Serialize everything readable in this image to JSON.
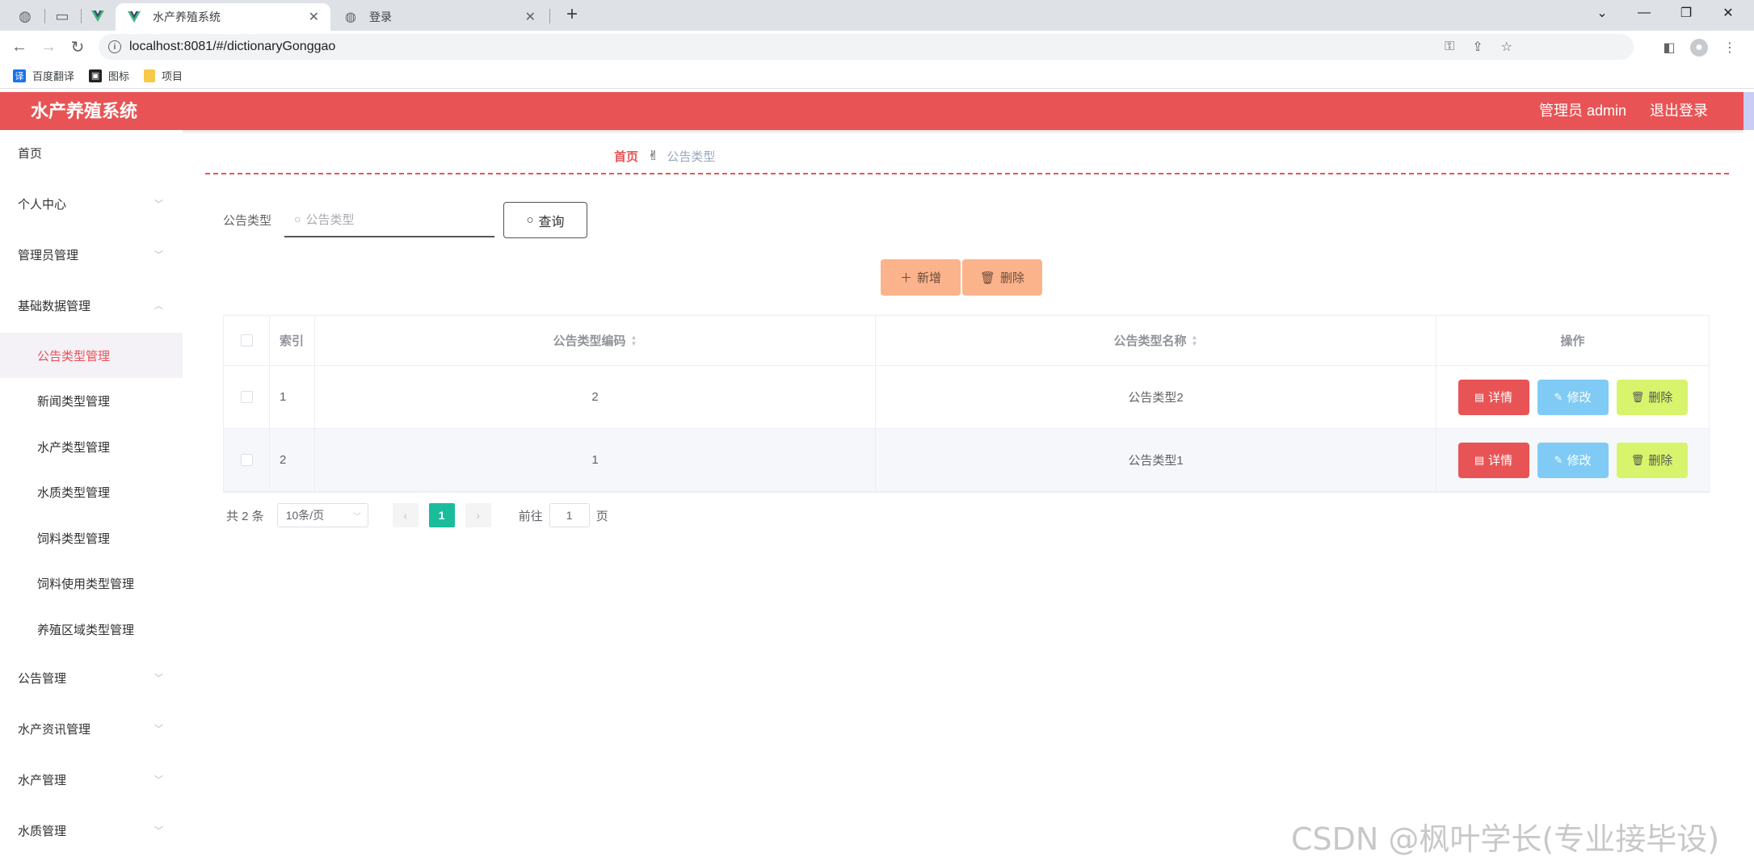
{
  "browser": {
    "tabs": [
      {
        "title": "水产养殖系统",
        "active": true
      },
      {
        "title": "登录",
        "active": false
      }
    ],
    "url": "localhost:8081/#/dictionaryGonggao",
    "bookmarks": [
      {
        "label": "百度翻译",
        "icon": "translate-icon",
        "color": "#1a73e8"
      },
      {
        "label": "图标",
        "icon": "image-icon",
        "color": "#222222"
      },
      {
        "label": "项目",
        "icon": "folder-icon",
        "color": "#f6c94b"
      }
    ]
  },
  "header": {
    "title": "水产养殖系统",
    "user": "管理员 admin",
    "logout": "退出登录",
    "color": "#e85455"
  },
  "sidebar": {
    "items": [
      {
        "label": "首页"
      },
      {
        "label": "个人中心"
      },
      {
        "label": "管理员管理"
      },
      {
        "label": "基础数据管理"
      },
      {
        "label": "公告管理"
      },
      {
        "label": "水产资讯管理"
      },
      {
        "label": "水产管理"
      },
      {
        "label": "水质管理"
      }
    ],
    "subitems": [
      {
        "label": "公告类型管理",
        "active": true
      },
      {
        "label": "新闻类型管理"
      },
      {
        "label": "水产类型管理"
      },
      {
        "label": "水质类型管理"
      },
      {
        "label": "饲料类型管理"
      },
      {
        "label": "饲料使用类型管理"
      },
      {
        "label": "养殖区域类型管理"
      }
    ]
  },
  "breadcrumb": {
    "home": "首页",
    "current": "公告类型"
  },
  "search": {
    "label": "公告类型",
    "placeholder": "公告类型",
    "button": "查询"
  },
  "actions": {
    "add": "新增",
    "delete": "删除"
  },
  "table": {
    "headers": {
      "index": "索引",
      "code": "公告类型编码",
      "name": "公告类型名称",
      "ops": "操作"
    },
    "rows": [
      {
        "index": "1",
        "code": "2",
        "name": "公告类型2"
      },
      {
        "index": "2",
        "code": "1",
        "name": "公告类型1"
      }
    ],
    "ops": {
      "detail": "详情",
      "edit": "修改",
      "delete": "删除"
    }
  },
  "pagination": {
    "total": "共 2 条",
    "page_size": "10条/页",
    "current": "1",
    "goto_prefix": "前往",
    "goto_value": "1",
    "goto_suffix": "页"
  },
  "watermark": "CSDN @枫叶学长(专业接毕设)"
}
